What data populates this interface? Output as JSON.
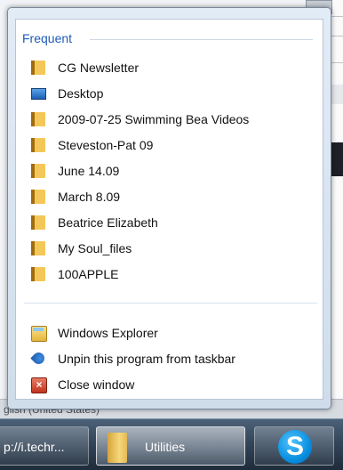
{
  "background": {
    "status_text": "glish (United States)"
  },
  "taskbar": {
    "items": [
      {
        "label": "p://i.techr..."
      },
      {
        "label": "Utilities"
      },
      {
        "label": "S"
      }
    ]
  },
  "jumplist": {
    "section_title": "Frequent",
    "frequent": [
      {
        "label": "CG Newsletter",
        "icon": "folder-icon"
      },
      {
        "label": "Desktop",
        "icon": "desktop-icon"
      },
      {
        "label": "2009-07-25 Swimming Bea Videos",
        "icon": "folder-icon"
      },
      {
        "label": "Steveston-Pat 09",
        "icon": "folder-icon"
      },
      {
        "label": "June 14.09",
        "icon": "folder-icon"
      },
      {
        "label": "March 8.09",
        "icon": "folder-icon"
      },
      {
        "label": "Beatrice Elizabeth",
        "icon": "folder-icon"
      },
      {
        "label": "My Soul_files",
        "icon": "folder-icon"
      },
      {
        "label": "100APPLE",
        "icon": "folder-icon"
      }
    ],
    "tasks": [
      {
        "label": "Windows Explorer",
        "icon": "windows-explorer-icon"
      },
      {
        "label": "Unpin this program from taskbar",
        "icon": "unpin-icon"
      },
      {
        "label": "Close window",
        "icon": "close-window-icon"
      }
    ]
  },
  "colors": {
    "accent": "#1e5bb8",
    "taskbar": "#34465a"
  }
}
